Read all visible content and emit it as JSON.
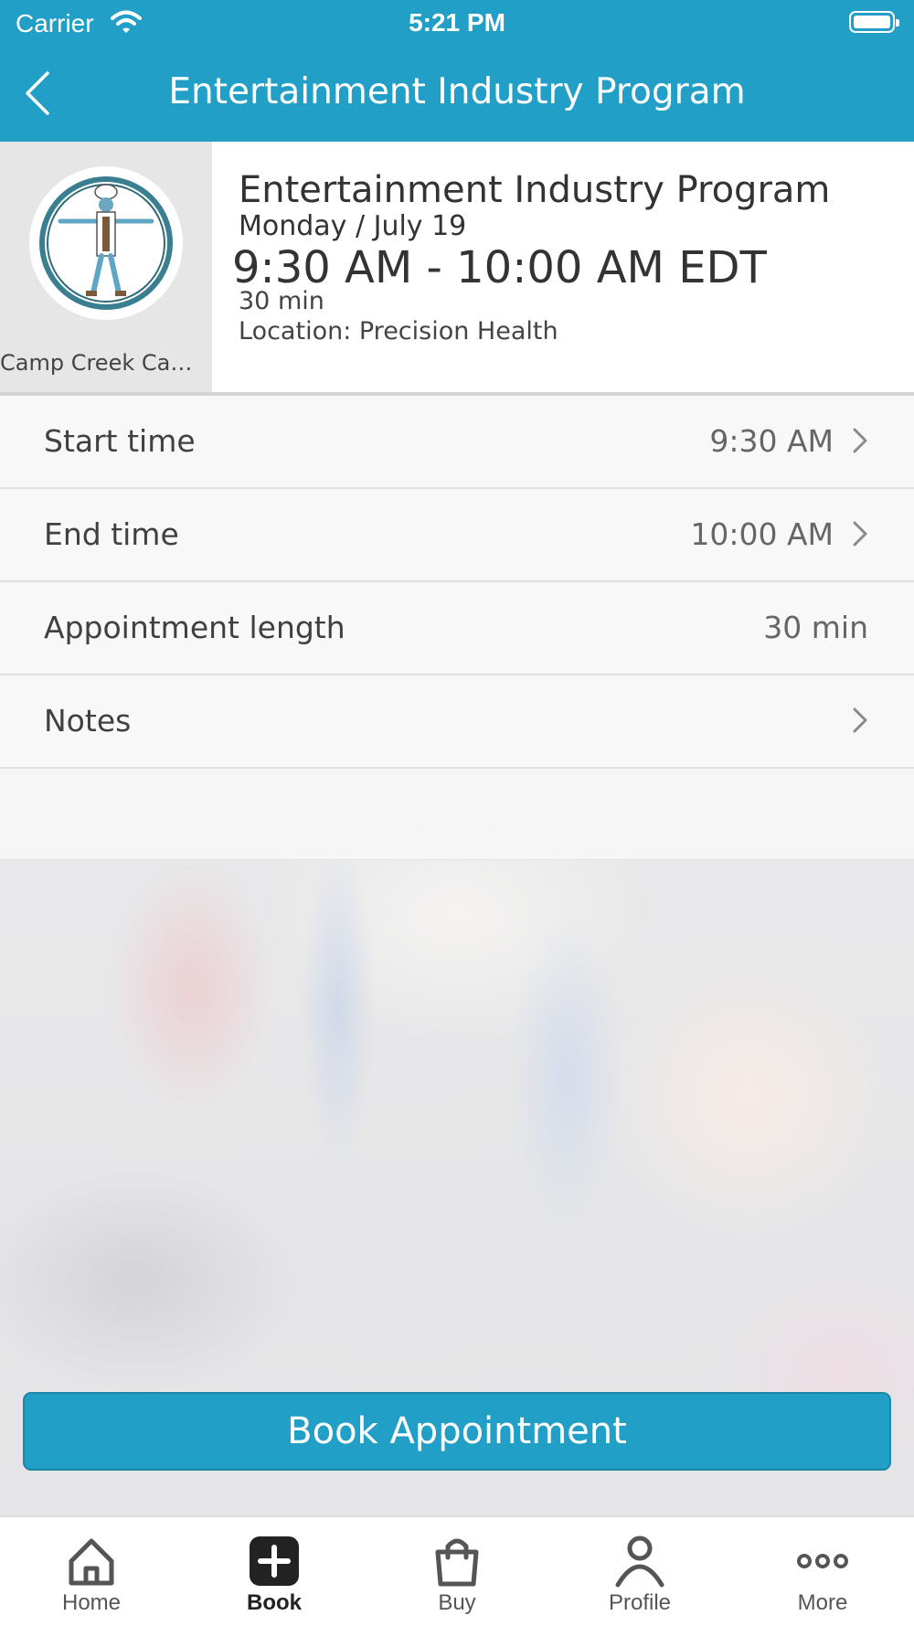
{
  "status_bar": {
    "carrier": "Carrier",
    "time": "5:21 PM"
  },
  "nav": {
    "title": "Entertainment Industry Program"
  },
  "event": {
    "provider": "Camp Creek Camp...",
    "title": "Entertainment Industry Program",
    "date": "Monday / July 19",
    "time_range": "9:30 AM - 10:00 AM EDT",
    "duration": "30 min",
    "location": "Location: Precision Health"
  },
  "details": {
    "start_time": {
      "label": "Start time",
      "value": "9:30 AM"
    },
    "end_time": {
      "label": "End time",
      "value": "10:00 AM"
    },
    "appointment_length": {
      "label": "Appointment length",
      "value": "30 min"
    },
    "notes": {
      "label": "Notes",
      "value": ""
    }
  },
  "actions": {
    "book_label": "Book Appointment"
  },
  "tabbar": {
    "items": [
      {
        "label": "Home",
        "icon": "home-icon",
        "active": false
      },
      {
        "label": "Book",
        "icon": "plus-square-icon",
        "active": true
      },
      {
        "label": "Buy",
        "icon": "shopping-bag-icon",
        "active": false
      },
      {
        "label": "Profile",
        "icon": "person-icon",
        "active": false
      },
      {
        "label": "More",
        "icon": "more-dots-icon",
        "active": false
      }
    ]
  },
  "colors": {
    "brand": "#229fc7",
    "header_text": "#ffffff",
    "active_tab": "#222222",
    "inactive_tab": "#555555"
  }
}
